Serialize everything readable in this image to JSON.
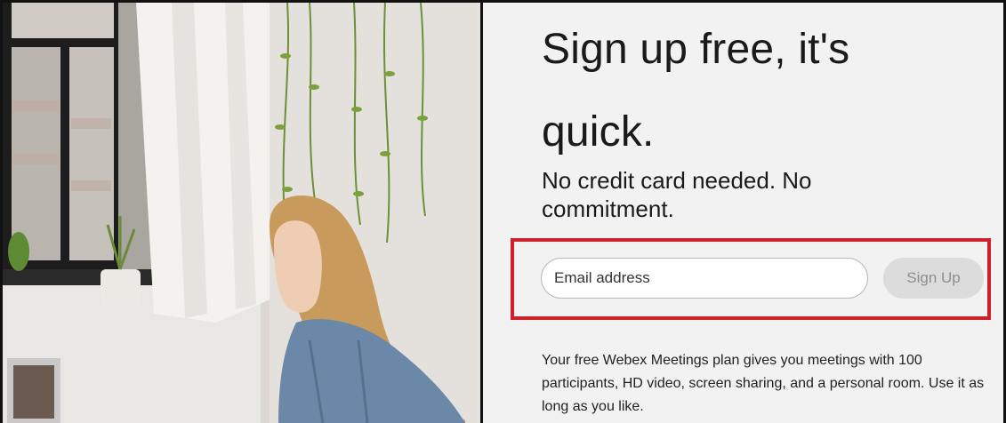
{
  "signup": {
    "headline": "Sign up free, it's quick.",
    "subheadline": "No credit card needed. No commitment.",
    "email_placeholder": "Email address",
    "email_value": "",
    "button_label": "Sign Up",
    "plan_description": "Your free Webex Meetings plan gives you meetings with 100 participants, HD video, screen sharing, and a personal room. Use it as long as you like."
  },
  "colors": {
    "highlight": "#d0202a",
    "background": "#f2f2f2",
    "button_disabled_bg": "#dcdcdc",
    "button_disabled_text": "#8e8e8e"
  },
  "hero_image": {
    "subject": "woman-working-on-laptop-photo"
  }
}
